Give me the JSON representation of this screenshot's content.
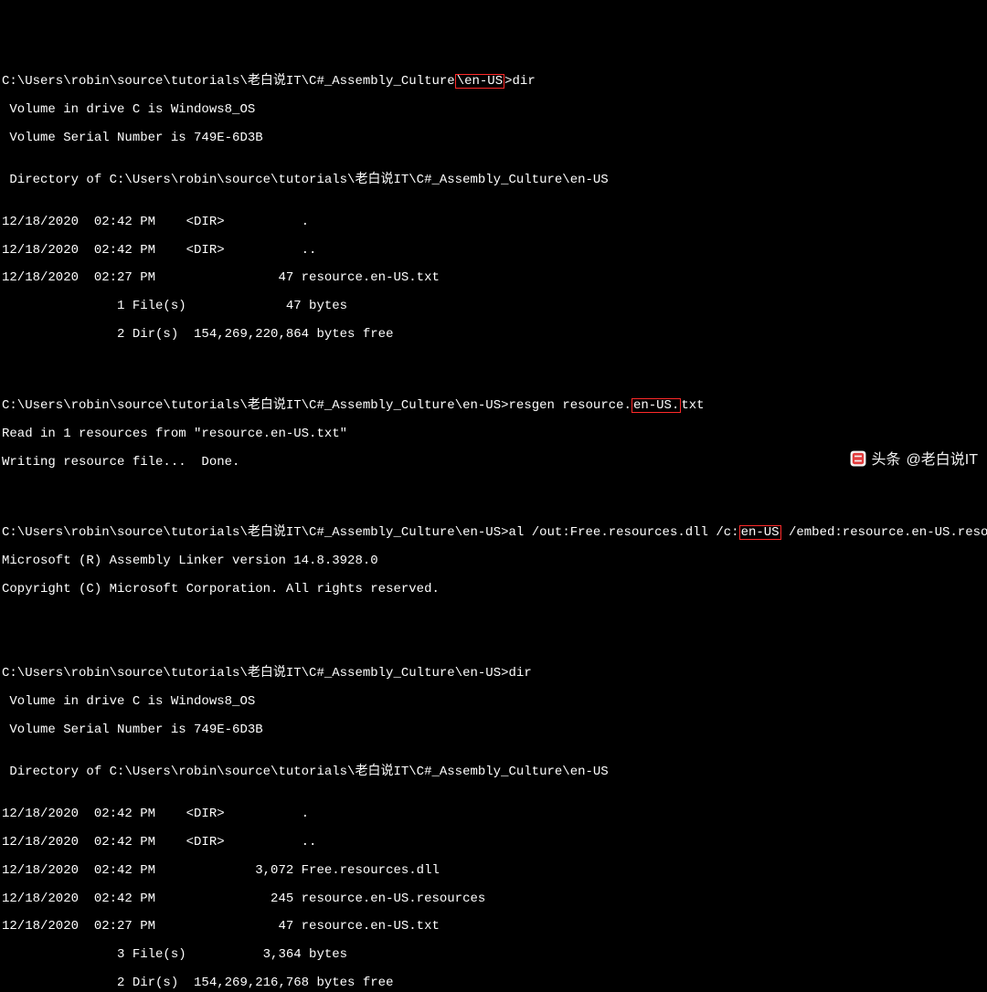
{
  "prompt_path": "C:\\Users\\robin\\source\\tutorials\\老白说IT\\C#_Assembly_Culture",
  "hl_enUS": "\\en-US",
  "hl_enUS_bare": "en-US",
  "hl_enUS_dot": "en-US.",
  "gt": ">",
  "cmd_dir": "dir",
  "cmd_resgen_pre": "resgen resource.",
  "cmd_resgen_post": "txt",
  "cmd_al_pre": "al /out:Free.resources.dll /c:",
  "cmd_al_post": " /embed:resource.en-US.resources",
  "volume_line": " Volume in drive C is Windows8_OS",
  "serial_line": " Volume Serial Number is 749E-6D3B",
  "dirof_line": " Directory of C:\\Users\\robin\\source\\tutorials\\老白说IT\\C#_Assembly_Culture\\en-US",
  "blank": "",
  "listing1": {
    "r1": "12/18/2020  02:42 PM    <DIR>          .",
    "r2": "12/18/2020  02:42 PM    <DIR>          ..",
    "r3": "12/18/2020  02:27 PM                47 resource.en-US.txt",
    "s1": "               1 File(s)             47 bytes",
    "s2": "               2 Dir(s)  154,269,220,864 bytes free"
  },
  "resgen_out1": "Read in 1 resources from \"resource.en-US.txt\"",
  "resgen_out2": "Writing resource file...  Done.",
  "al_out1": "Microsoft (R) Assembly Linker version 14.8.3928.0",
  "al_out2": "Copyright (C) Microsoft Corporation. All rights reserved.",
  "listing2": {
    "r1": "12/18/2020  02:42 PM    <DIR>          .",
    "r2": "12/18/2020  02:42 PM    <DIR>          ..",
    "r3": "12/18/2020  02:42 PM             3,072 Free.resources.dll",
    "r4": "12/18/2020  02:42 PM               245 resource.en-US.resources",
    "r5": "12/18/2020  02:27 PM                47 resource.en-US.txt",
    "s1": "               3 File(s)          3,364 bytes",
    "s2": "               2 Dir(s)  154,269,216,768 bytes free"
  },
  "watermark_prefix": "头条",
  "watermark_handle": "@老白说IT"
}
